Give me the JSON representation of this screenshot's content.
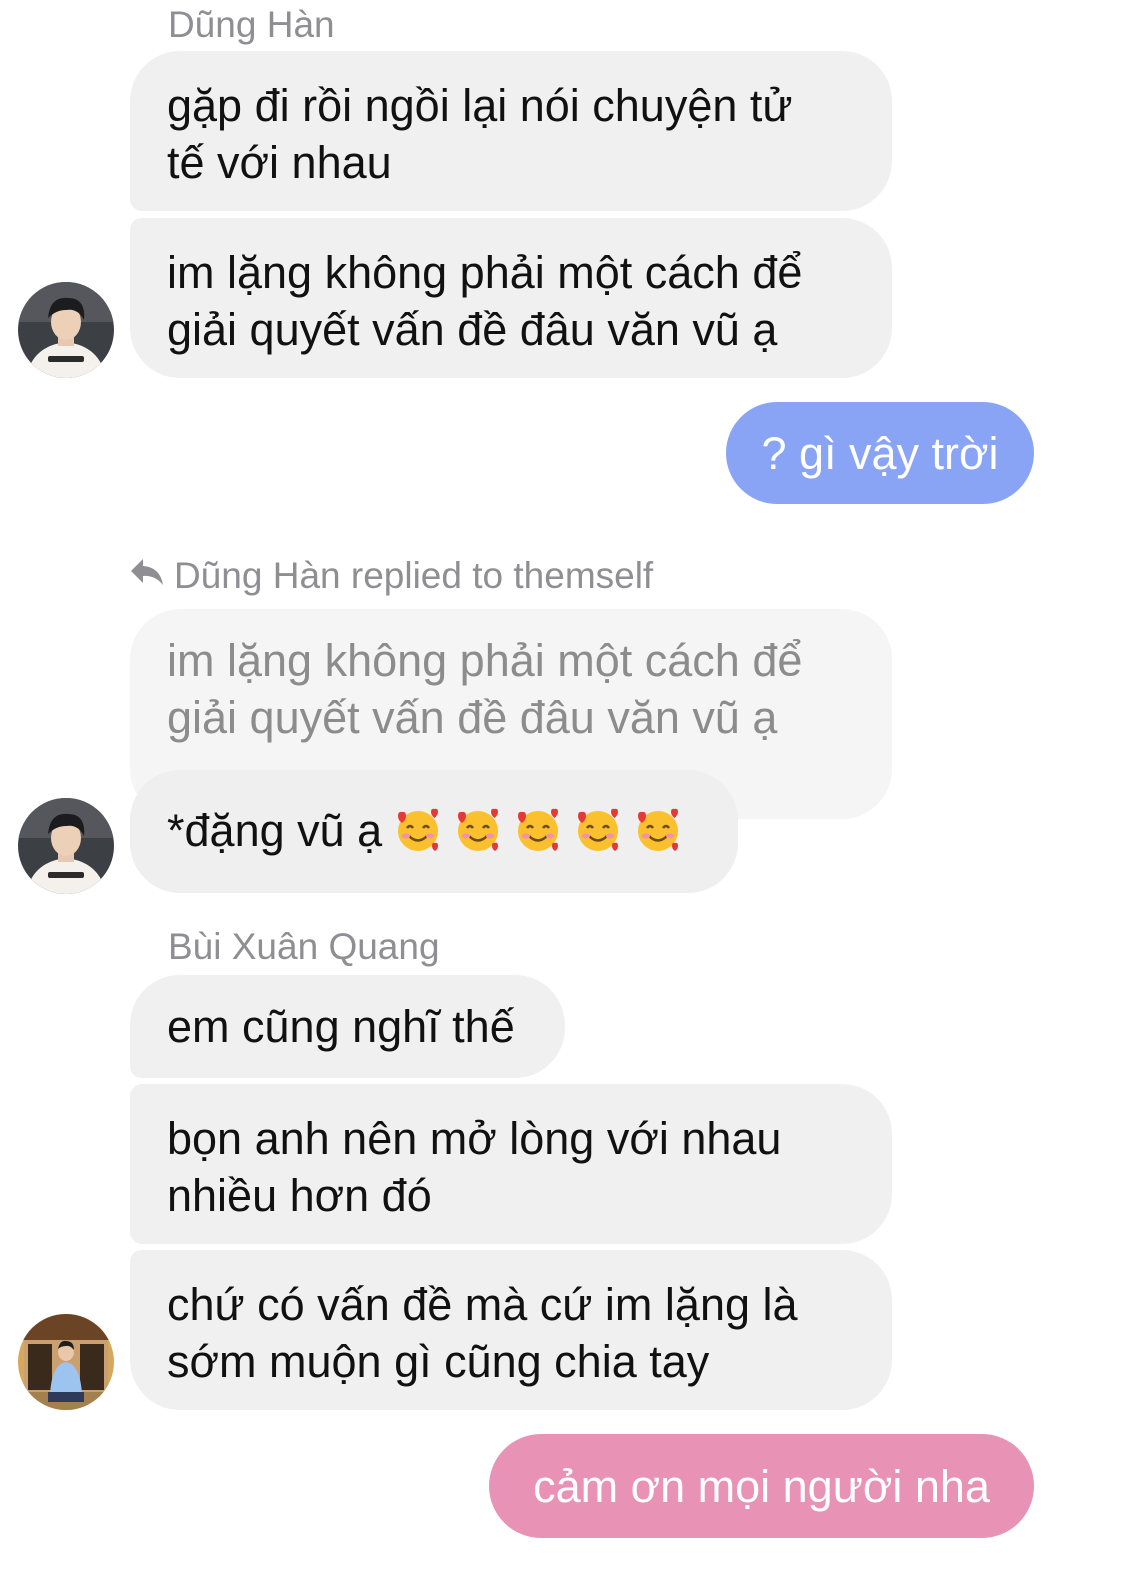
{
  "colors": {
    "incoming_bubble": "#f0f0f0",
    "outgoing_blue": "#8aa4f5",
    "outgoing_pink": "#e893b6",
    "secondary_text": "#8e8e93"
  },
  "messages": {
    "group1": {
      "sender": "Dũng Hàn",
      "msg1": {
        "line1": "gặp đi rồi ngồi lại nói chuyện tử",
        "line2": "tế với nhau"
      },
      "msg2": {
        "line1": "im lặng không phải một cách để",
        "line2": "giải quyết vấn đề đâu văn vũ ạ"
      }
    },
    "outgoing1": {
      "text": "? gì vậy trời"
    },
    "group2": {
      "reply_label": "Dũng Hàn replied to themself",
      "quoted": {
        "line1": "im lặng không phải một cách để",
        "line2": "giải quyết vấn đề đâu văn vũ ạ"
      },
      "msg": {
        "text": "*đặng vũ ạ",
        "emoji": "smiling-face-with-hearts-emoji",
        "emoji_count": 5
      }
    },
    "group3": {
      "sender": "Bùi Xuân Quang",
      "msg1": {
        "text": "em cũng nghĩ thế"
      },
      "msg2": {
        "line1": "bọn anh nên mở lòng với nhau",
        "line2": "nhiều hơn đó"
      },
      "msg3": {
        "line1": "chứ có vấn đề mà cứ im lặng là",
        "line2": "sớm muộn gì cũng chia tay"
      }
    },
    "outgoing2": {
      "text": "cảm ơn mọi người nha"
    }
  },
  "icons": {
    "reply": "reply-arrow-icon",
    "avatar_dung_han": "avatar-photo",
    "avatar_bui_xuan_quang": "avatar-photo"
  }
}
